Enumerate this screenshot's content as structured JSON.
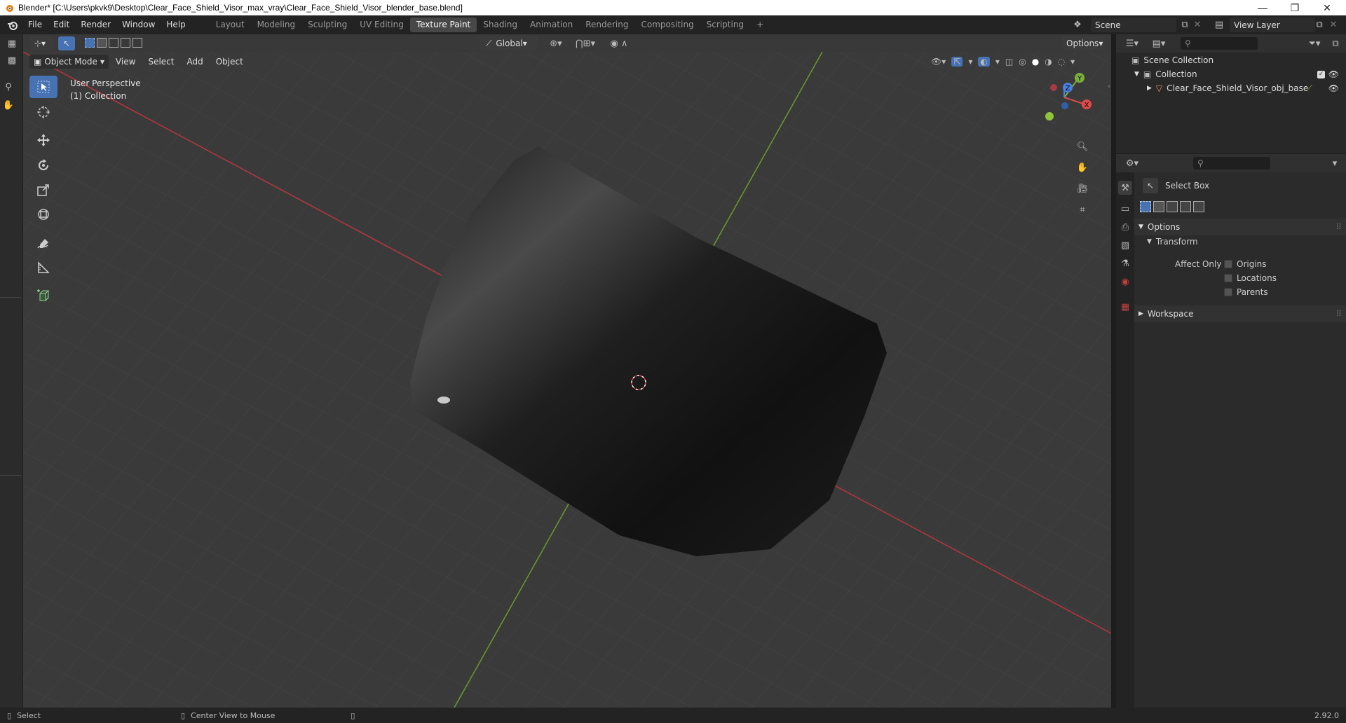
{
  "window": {
    "title": "Blender* [C:\\Users\\pkvk9\\Desktop\\Clear_Face_Shield_Visor_max_vray\\Clear_Face_Shield_Visor_blender_base.blend]",
    "minimize": "—",
    "maximize": "❐",
    "close": "✕"
  },
  "menu": [
    "File",
    "Edit",
    "Render",
    "Window",
    "Help"
  ],
  "workspaces": {
    "tabs": [
      "Layout",
      "Modeling",
      "Sculpting",
      "UV Editing",
      "Texture Paint",
      "Shading",
      "Animation",
      "Rendering",
      "Compositing",
      "Scripting"
    ],
    "active": "Texture Paint",
    "add": "+"
  },
  "scene": {
    "label": "Scene"
  },
  "view_layer": {
    "label": "View Layer"
  },
  "viewport_header": {
    "transform_orientation": "Global",
    "options": "Options",
    "mode": "Object Mode",
    "menus": [
      "View",
      "Select",
      "Add",
      "Object"
    ]
  },
  "viewport": {
    "perspective": "User Perspective",
    "collection": "(1) Collection",
    "gizmo": {
      "x": "X",
      "y": "Y",
      "z": "Z"
    },
    "colors": {
      "x_axis": "#b5373f",
      "y_axis": "#6d9a2a",
      "object": "#161616",
      "grid": "#454545"
    }
  },
  "outliner": {
    "scene_collection": "Scene Collection",
    "collection": "Collection",
    "object": "Clear_Face_Shield_Visor_obj_base"
  },
  "properties": {
    "tool_name": "Select Box",
    "options_panel": "Options",
    "transform_panel": "Transform",
    "affect_only": "Affect Only",
    "checkboxes": [
      "Origins",
      "Locations",
      "Parents"
    ],
    "workspace_panel": "Workspace"
  },
  "status": {
    "select": "Select",
    "center_view": "Center View to Mouse",
    "version": "2.92.0"
  }
}
